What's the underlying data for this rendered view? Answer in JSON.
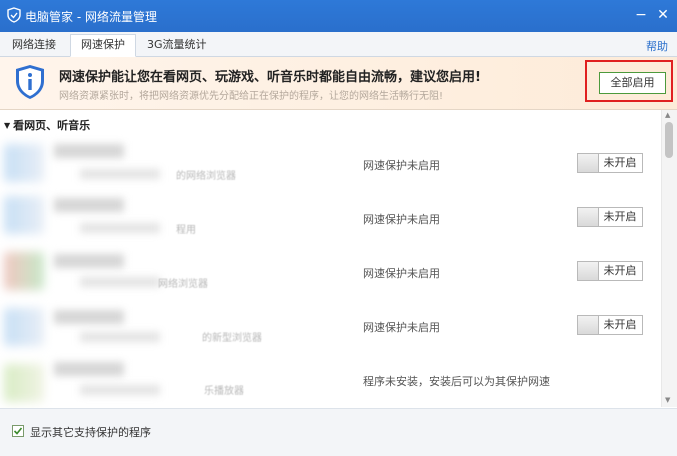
{
  "window": {
    "title": "电脑管家 - 网络流量管理",
    "minimize_glyph": "−",
    "close_glyph": "✕"
  },
  "tabs": [
    {
      "label": "网络连接",
      "active": false
    },
    {
      "label": "网速保护",
      "active": true
    },
    {
      "label": "3G流量统计",
      "active": false
    }
  ],
  "help_label": "帮助",
  "banner": {
    "headline": "网速保护能让您在看网页、玩游戏、听音乐时都能自由流畅，建议您启用!",
    "subtext": "网络资源紧张时，将把网络资源优先分配给正在保护的程序，让您的网络生活畅行无阻!",
    "enable_all_label": "全部启用",
    "icon": "shield-info-icon"
  },
  "section": {
    "title": "看网页、听音乐"
  },
  "programs": [
    {
      "desc_tail": "的网络浏览器",
      "status": "网速保护未启用",
      "toggle_label": "未开启",
      "installed": true
    },
    {
      "desc_tail": "程用",
      "status": "网速保护未启用",
      "toggle_label": "未开启",
      "installed": true
    },
    {
      "desc_tail": "网络浏览器",
      "status": "网速保护未启用",
      "toggle_label": "未开启",
      "installed": true
    },
    {
      "desc_tail": "的新型浏览器",
      "status": "网速保护未启用",
      "toggle_label": "未开启",
      "installed": true
    },
    {
      "desc_tail": "乐播放器",
      "status": "程序未安装，安装后可以为其保护网速",
      "toggle_label": "",
      "installed": false
    }
  ],
  "footer": {
    "checkbox_label": "显示其它支持保护的程序",
    "checked": true
  },
  "colors": {
    "titlebar": "#2a6fcc",
    "highlight_border": "#e02020",
    "enable_button_border": "#4c9a3c"
  }
}
